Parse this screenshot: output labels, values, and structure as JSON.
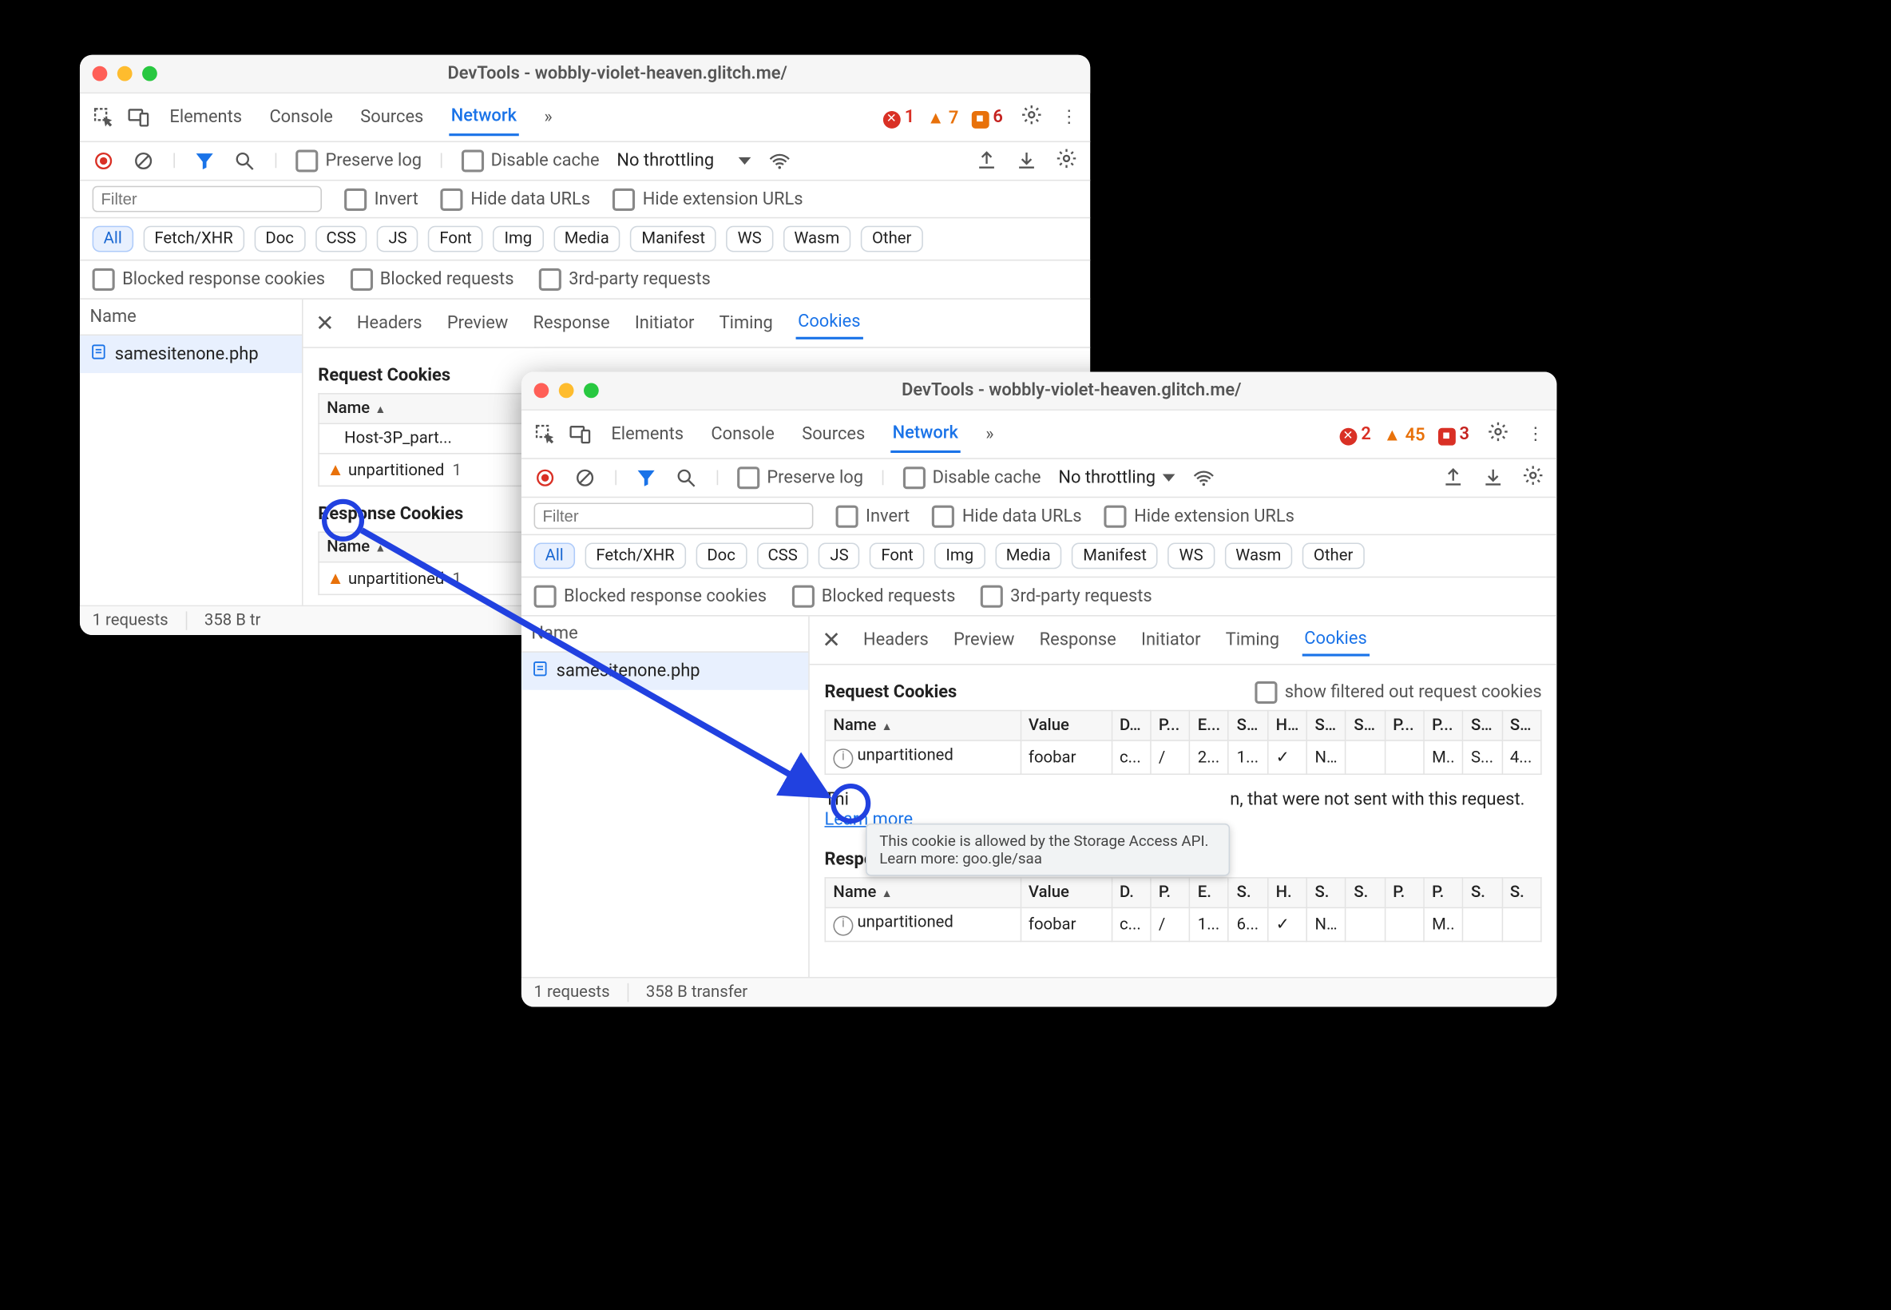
{
  "shared": {
    "window_title": "DevTools - wobbly-violet-heaven.glitch.me/",
    "top_tabs": {
      "elements": "Elements",
      "console": "Console",
      "sources": "Sources",
      "network": "Network"
    },
    "more_chevron": "»",
    "toolbar": {
      "preserve_log": "Preserve log",
      "disable_cache": "Disable cache",
      "throttling": "No throttling"
    },
    "filter_placeholder": "Filter",
    "filter_opts": {
      "invert": "Invert",
      "hide_data": "Hide data URLs",
      "hide_ext": "Hide extension URLs"
    },
    "type_chips": [
      "All",
      "Fetch/XHR",
      "Doc",
      "CSS",
      "JS",
      "Font",
      "Img",
      "Media",
      "Manifest",
      "WS",
      "Wasm",
      "Other"
    ],
    "extra_opts": {
      "blocked_cookies": "Blocked response cookies",
      "blocked_req": "Blocked requests",
      "third_party": "3rd-party requests"
    },
    "col_name": "Name",
    "detail_tabs": {
      "headers": "Headers",
      "preview": "Preview",
      "response": "Response",
      "initiator": "Initiator",
      "timing": "Timing",
      "cookies": "Cookies"
    },
    "request_name": "samesitenone.php",
    "sections": {
      "request": "Request Cookies",
      "response": "Response Cookies"
    },
    "show_filtered": "show filtered out request cookies",
    "cookie_cols_short": {
      "name": "Name",
      "value": "Value",
      "d": "D...",
      "p": "P...",
      "e": "E...",
      "s": "S...",
      "h": "H...",
      "s2": "S...",
      "s3": "S...",
      "p2": "P...",
      "p3": "P...",
      "s4": "S...",
      "s5": "S..."
    },
    "cookie_cols_shorter": {
      "d": "D.",
      "p": "P.",
      "e": "E.",
      "s": "S.",
      "h": "H.",
      "s2": "S.",
      "s3": "S.",
      "p2": "P.",
      "p3": "P.",
      "s4": "S.",
      "s5": "S."
    },
    "status_requests": "1 requests",
    "learn_more": "Learn more"
  },
  "windowA": {
    "counts": {
      "errors": "1",
      "warnings": "7",
      "issues": "6"
    },
    "cookies": {
      "request": {
        "rows": [
          {
            "name": "Host-3P_part...",
            "trunc": ""
          },
          {
            "name": "unpartitioned",
            "trunc": "1",
            "warn": true
          }
        ]
      },
      "response": {
        "rows": [
          {
            "name": "unpartitioned",
            "trunc": "1",
            "warn": true
          }
        ]
      }
    },
    "status_transfer": "358 B tr"
  },
  "windowB": {
    "counts": {
      "errors": "2",
      "warnings": "45",
      "issues": "3"
    },
    "request_cookie_row": {
      "name": "unpartitioned",
      "value": "foobar",
      "d": "c...",
      "p": "/",
      "e": "2...",
      "s": "1...",
      "h": "✓",
      "s2": "N...",
      "s3": "",
      "p2": "",
      "p3": "M..",
      "s4": "S...",
      "s5": "4..."
    },
    "excluded_text_1": "Thi",
    "excluded_text_2": "n, that were not sent with this request.",
    "response_cookie_row": {
      "name": "unpartitioned",
      "value": "foobar",
      "d": "c...",
      "p": "/",
      "e": "1...",
      "s": "6...",
      "h": "✓",
      "s2": "N...",
      "s3": "",
      "p2": "",
      "p3": "M..",
      "s4": "",
      "s5": ""
    },
    "status_transfer": "358 B transfer",
    "tooltip_text": "This cookie is allowed by the Storage Access API. Learn more: goo.gle/saa"
  }
}
